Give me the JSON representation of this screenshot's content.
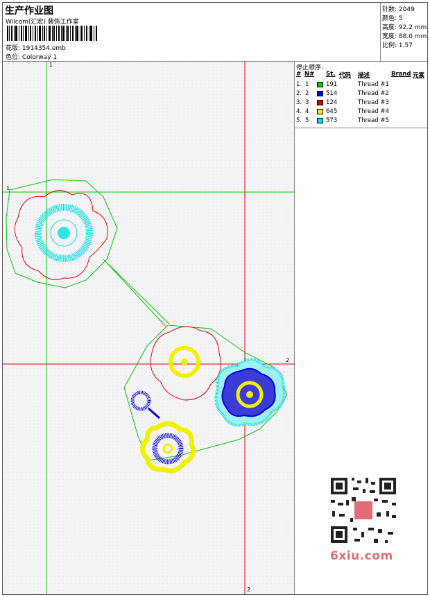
{
  "header": {
    "title": "生产作业图",
    "company": "Wilcom(汇宏) 装饰工作室",
    "file_label": "花版:",
    "file_value": "1914354.emb",
    "colorway_label": "色位:",
    "colorway_value": "Colorway 1"
  },
  "stats": {
    "stitches": "针数: 2049",
    "colors": "颜色: 5",
    "height": "高度: 92.2 mm",
    "width": "宽度: 88.0 mm",
    "scale": "比例: 1.57"
  },
  "stop_table": {
    "title": "停止顺序:",
    "headers": {
      "num": "#",
      "n": "N#",
      "st": "St.",
      "code": "代码",
      "desc": "描述",
      "brand": "Brand",
      "element": "元素"
    },
    "rows": [
      {
        "num": "1.",
        "n": "1",
        "color": "#00c800",
        "code": "191",
        "desc": "Thread #1"
      },
      {
        "num": "2.",
        "n": "2",
        "color": "#0000e0",
        "code": "514",
        "desc": "Thread #2"
      },
      {
        "num": "3.",
        "n": "3",
        "color": "#e00000",
        "code": "124",
        "desc": "Thread #3"
      },
      {
        "num": "4.",
        "n": "4",
        "color": "#f0f000",
        "code": "645",
        "desc": "Thread #4"
      },
      {
        "num": "5.",
        "n": "5",
        "color": "#00e0e0",
        "code": "573",
        "desc": "Thread #5"
      }
    ]
  },
  "axis_labels": {
    "v1": "1",
    "h1": "1",
    "h2": "2",
    "v2": "2"
  },
  "colors": {
    "green": "#00c800",
    "red": "#e00000",
    "blue": "#0000e0",
    "yellow": "#f0f000",
    "cyan": "#00e0e0"
  },
  "watermark": "6xiu.com"
}
